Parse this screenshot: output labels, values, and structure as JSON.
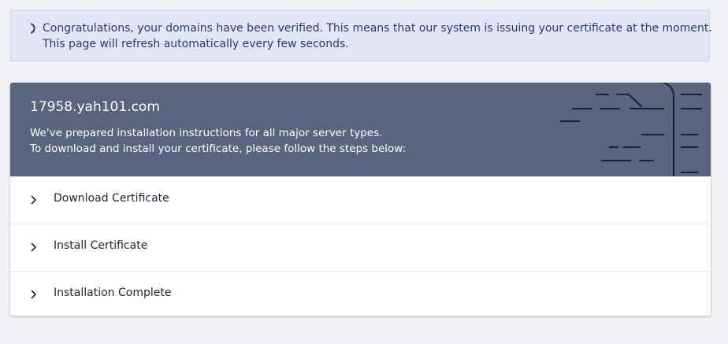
{
  "alert": {
    "line1": "Congratulations, your domains have been verified. This means that our system is issuing your certificate at the moment.",
    "line2": "This page will refresh automatically every few seconds.",
    "icon": "loading-spinner-icon"
  },
  "card": {
    "domain": "17958.yah101.com",
    "description_line1": "We've prepared installation instructions for all major server types.",
    "description_line2": "To download and install your certificate, please follow the steps below:",
    "header_color": "#586480"
  },
  "steps": [
    {
      "label": "Download Certificate",
      "icon": "chevron-right-icon"
    },
    {
      "label": "Install Certificate",
      "icon": "chevron-right-icon"
    },
    {
      "label": "Installation Complete",
      "icon": "chevron-right-icon"
    }
  ],
  "colors": {
    "alert_background": "#e1e5f6",
    "alert_text": "#2b3a67",
    "page_background": "#f0f1f4"
  }
}
